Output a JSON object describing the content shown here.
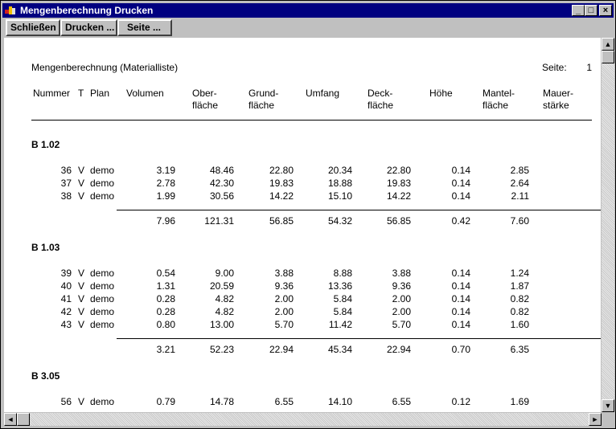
{
  "window": {
    "title": "Mengenberechnung Drucken"
  },
  "toolbar": {
    "close_label": "Schließen",
    "print_label": "Drucken ...",
    "page_label": "Seite ..."
  },
  "report": {
    "title": "Mengenberechnung  (Materialliste)",
    "page_label": "Seite:",
    "page_number": "1",
    "headers": {
      "nummer": "Nummer",
      "t": "T",
      "plan": "Plan",
      "volumen": "Volumen",
      "oberflaeche": [
        "Ober-",
        "fläche"
      ],
      "grundflaeche": [
        "Grund-",
        "fläche"
      ],
      "umfang": "Umfang",
      "deckflaeche": [
        "Deck-",
        "fläche"
      ],
      "hoehe": "Höhe",
      "mantelflaeche": [
        "Mantel-",
        "fläche"
      ],
      "mauerstaerke": [
        "Mauer-",
        "stärke"
      ]
    },
    "groups": [
      {
        "name": "B 1.02",
        "rows": [
          [
            "36",
            "V",
            "demo",
            "3.19",
            "48.46",
            "22.80",
            "20.34",
            "22.80",
            "0.14",
            "2.85"
          ],
          [
            "37",
            "V",
            "demo",
            "2.78",
            "42.30",
            "19.83",
            "18.88",
            "19.83",
            "0.14",
            "2.64"
          ],
          [
            "38",
            "V",
            "demo",
            "1.99",
            "30.56",
            "14.22",
            "15.10",
            "14.22",
            "0.14",
            "2.11"
          ]
        ],
        "totals": [
          "7.96",
          "121.31",
          "56.85",
          "54.32",
          "56.85",
          "0.42",
          "7.60"
        ]
      },
      {
        "name": "B 1.03",
        "rows": [
          [
            "39",
            "V",
            "demo",
            "0.54",
            "9.00",
            "3.88",
            "8.88",
            "3.88",
            "0.14",
            "1.24"
          ],
          [
            "40",
            "V",
            "demo",
            "1.31",
            "20.59",
            "9.36",
            "13.36",
            "9.36",
            "0.14",
            "1.87"
          ],
          [
            "41",
            "V",
            "demo",
            "0.28",
            "4.82",
            "2.00",
            "5.84",
            "2.00",
            "0.14",
            "0.82"
          ],
          [
            "42",
            "V",
            "demo",
            "0.28",
            "4.82",
            "2.00",
            "5.84",
            "2.00",
            "0.14",
            "0.82"
          ],
          [
            "43",
            "V",
            "demo",
            "0.80",
            "13.00",
            "5.70",
            "11.42",
            "5.70",
            "0.14",
            "1.60"
          ]
        ],
        "totals": [
          "3.21",
          "52.23",
          "22.94",
          "45.34",
          "22.94",
          "0.70",
          "6.35"
        ]
      },
      {
        "name": "B 3.05",
        "rows": [
          [
            "56",
            "V",
            "demo",
            "0.79",
            "14.78",
            "6.55",
            "14.10",
            "6.55",
            "0.12",
            "1.69"
          ]
        ]
      }
    ]
  },
  "icons": {
    "app": "app-logo-icon",
    "minimize": "minimize-icon",
    "maximize": "maximize-icon",
    "close": "close-icon",
    "scroll_up": "arrow-up-icon",
    "scroll_down": "arrow-down-icon",
    "scroll_left": "arrow-left-icon",
    "scroll_right": "arrow-right-icon"
  },
  "colors": {
    "titlebar": "#000080",
    "face": "#c0c0c0",
    "paper": "#ffffff"
  }
}
